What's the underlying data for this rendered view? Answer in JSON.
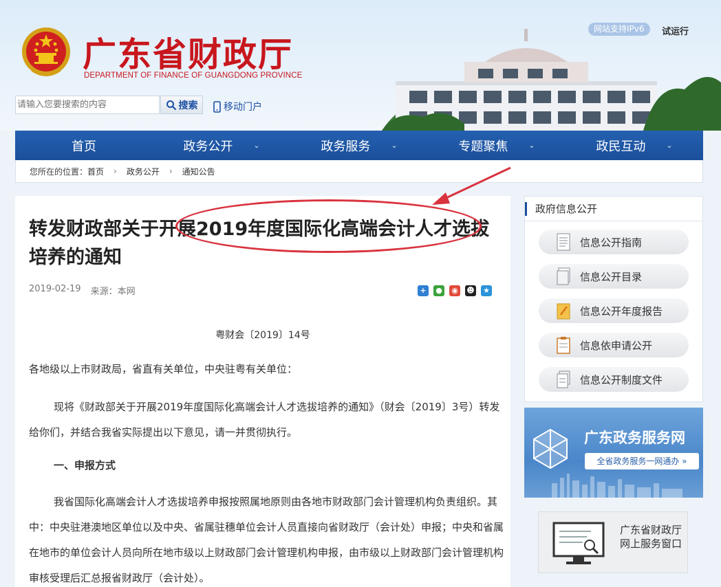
{
  "header": {
    "site_title": "广东省财政厅",
    "site_subtitle": "DEPARTMENT OF FINANCE OF GUANGDONG PROVINCE",
    "ipv6_badge": "网站支持IPv6",
    "trial_text": "试运行",
    "search": {
      "placeholder": "请输入您要搜索的内容",
      "button_label": "搜索"
    },
    "mobile_label": "移动门户"
  },
  "nav": {
    "items": [
      {
        "label": "首页",
        "has_dropdown": false
      },
      {
        "label": "政务公开",
        "has_dropdown": true
      },
      {
        "label": "政务服务",
        "has_dropdown": true
      },
      {
        "label": "专题聚焦",
        "has_dropdown": true
      },
      {
        "label": "政民互动",
        "has_dropdown": true
      }
    ],
    "chevron": "⌄"
  },
  "breadcrumb": {
    "prefix": "您所在的位置：",
    "items": [
      "首页",
      "政务公开",
      "通知公告"
    ],
    "separator": "›"
  },
  "article": {
    "title": "转发财政部关于开展2019年度国际化高端会计人才选拔培养的通知",
    "date": "2019-02-19",
    "source": "来源：本网",
    "share_icons": [
      "plus-share-icon",
      "wechat-icon",
      "weibo-icon",
      "qq-icon",
      "qzone-icon"
    ],
    "doc_number": "粤财会〔2019〕14号",
    "salutation": "各地级以上市财政局，省直有关单位，中央驻粤有关单位：",
    "para1": "现将《财政部关于开展2019年度国际化高端会计人才选拔培养的通知》（财会〔2019〕3号）转发给你们，并结合我省实际提出以下意见，请一并贯彻执行。",
    "heading1": "一、申报方式",
    "para2": "我省国际化高端会计人才选拔培养申报按照属地原则由各地市财政部门会计管理机构负责组织。其中：中央驻港澳地区单位以及中央、省属驻穗单位会计人员直接向省财政厅（会计处）申报；中央和省属在地市的单位会计人员向所在地市级以上财政部门会计管理机构申报，由市级以上财政部门会计管理机构审核受理后汇总报省财政厅（会计处）。"
  },
  "sidebar": {
    "panel_title": "政府信息公开",
    "buttons": [
      {
        "label": "信息公开指南",
        "icon": "document-icon"
      },
      {
        "label": "信息公开目录",
        "icon": "folder-icon"
      },
      {
        "label": "信息公开年度报告",
        "icon": "report-icon"
      },
      {
        "label": "信息依申请公开",
        "icon": "clipboard-icon"
      },
      {
        "label": "信息公开制度文件",
        "icon": "files-icon"
      }
    ],
    "banner": {
      "title": "广东政务服务网",
      "subtitle": "全省政务服务一网通办 »"
    },
    "online_service": "广东省财政厅网上服务窗口"
  },
  "colors": {
    "brand_red": "#c8161d",
    "nav_blue": "#1b4f9b",
    "annotation_red": "#d9333f"
  }
}
